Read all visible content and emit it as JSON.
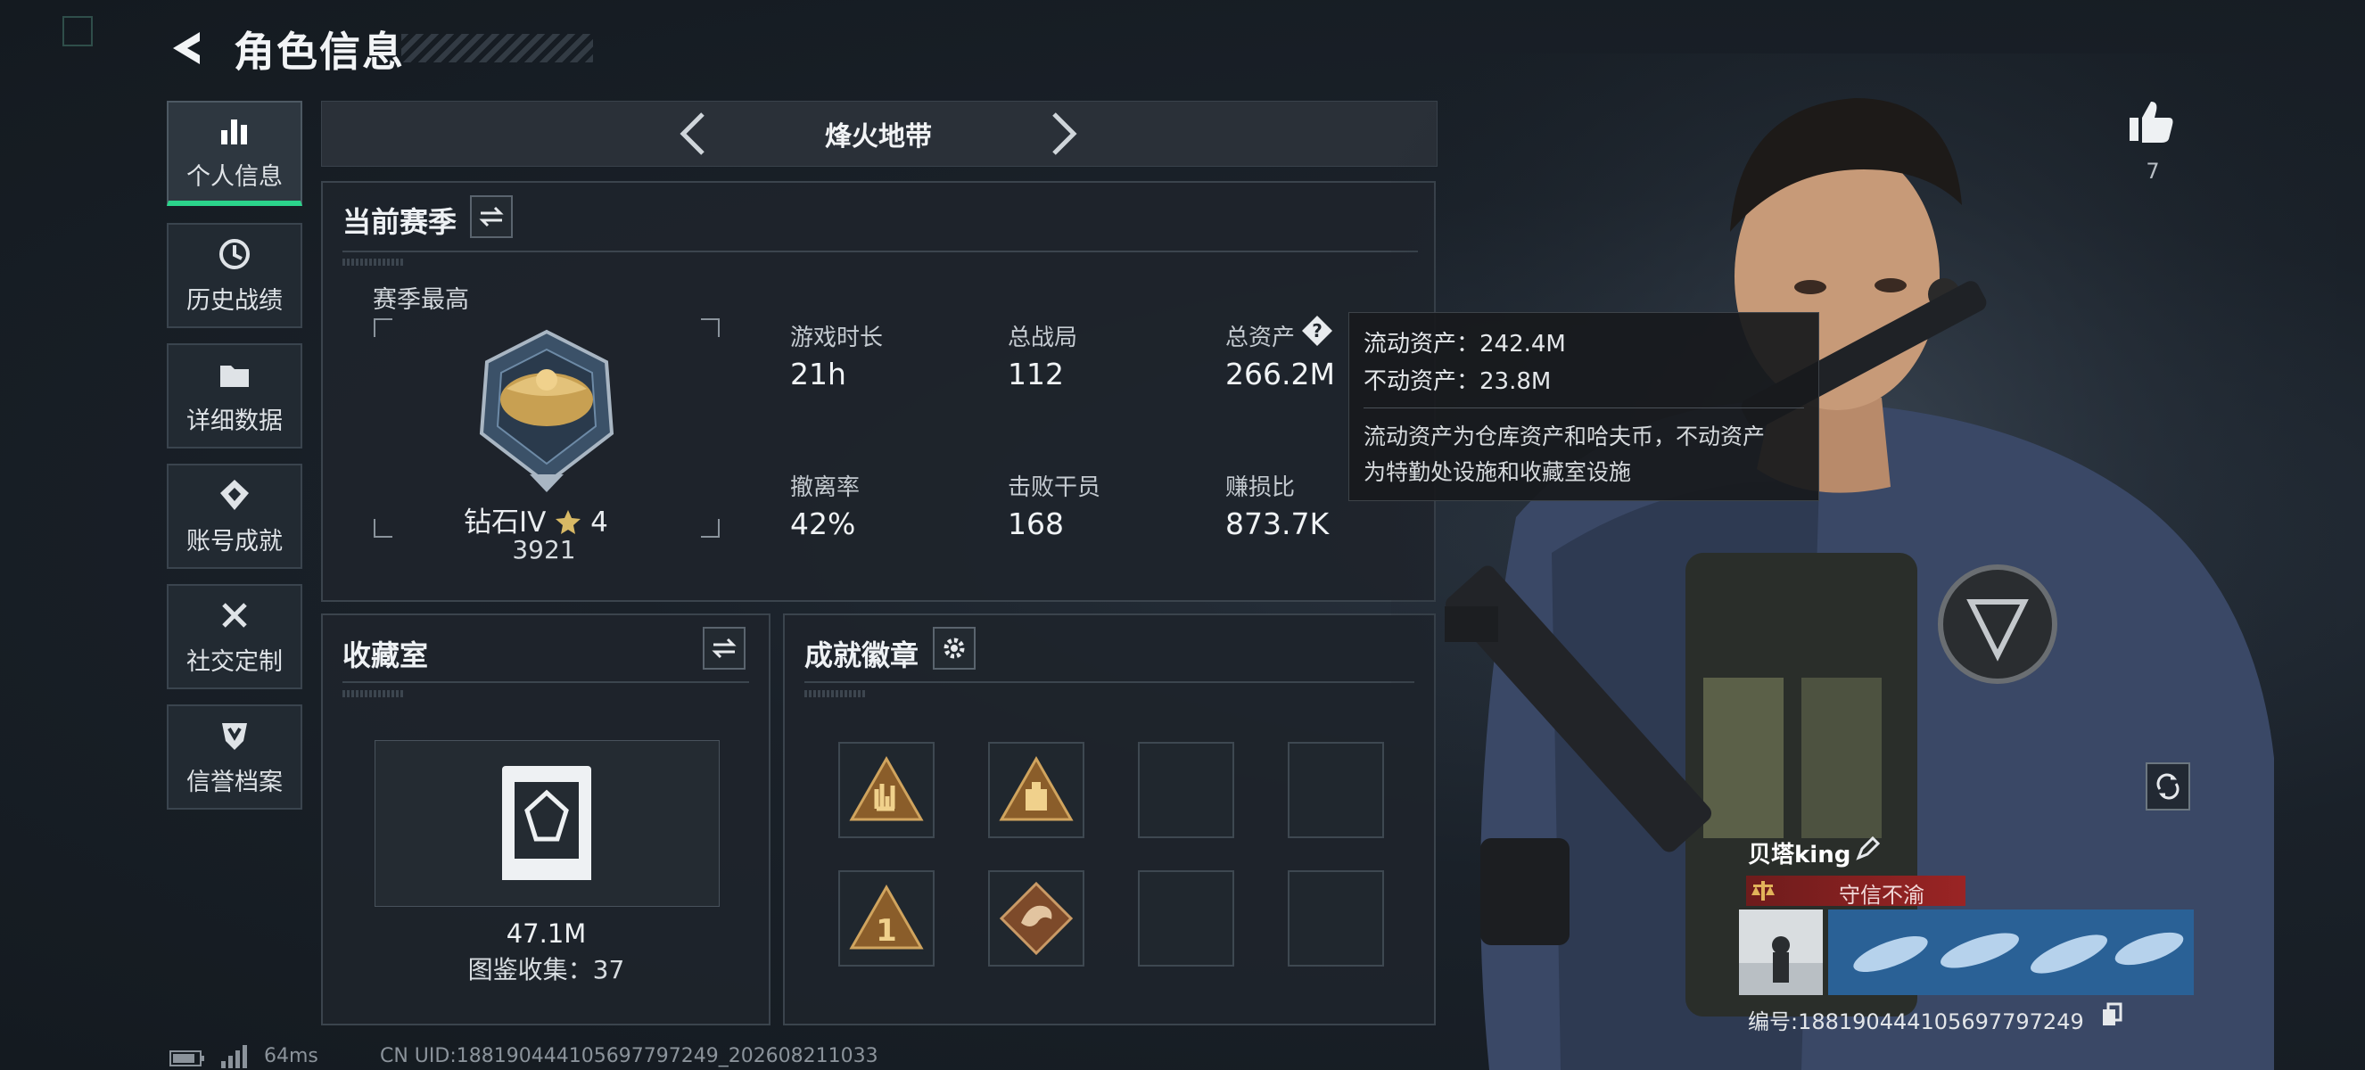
{
  "header": {
    "title": "角色信息"
  },
  "sidebar": {
    "items": [
      {
        "label": "个人信息",
        "icon": "bar-chart-icon",
        "active": true
      },
      {
        "label": "历史战绩",
        "icon": "history-icon"
      },
      {
        "label": "详细数据",
        "icon": "folder-icon"
      },
      {
        "label": "账号成就",
        "icon": "achievement-icon"
      },
      {
        "label": "社交定制",
        "icon": "tools-icon"
      },
      {
        "label": "信誉档案",
        "icon": "credit-icon"
      }
    ]
  },
  "mode": {
    "name": "烽火地带"
  },
  "season": {
    "title": "当前赛季",
    "best_label": "赛季最高",
    "rank_name": "钻石IV",
    "rank_stars": "4",
    "rank_score": "3921",
    "stats": [
      {
        "label": "游戏时长",
        "value": "21h"
      },
      {
        "label": "总战局",
        "value": "112"
      },
      {
        "label": "总资产",
        "value": "266.2M"
      },
      {
        "label": "撤离率",
        "value": "42%"
      },
      {
        "label": "击败干员",
        "value": "168"
      },
      {
        "label": "赚损比",
        "value": "873.7K"
      }
    ]
  },
  "tooltip": {
    "liquid": "流动资产：242.4M",
    "fixed": "不动资产：23.8M",
    "desc_line1": "流动资产为仓库资产和哈夫币，不动资产",
    "desc_line2": "为特勤处设施和收藏室设施"
  },
  "collection": {
    "title": "收藏室",
    "value": "47.1M",
    "count": "图鉴收集：37"
  },
  "achievements": {
    "title": "成就徽章",
    "badges": [
      "rock-hand-badge",
      "loot-crate-badge",
      "",
      "",
      "number-one-badge",
      "dragon-badge",
      "",
      ""
    ]
  },
  "likes": {
    "count": "7"
  },
  "player": {
    "name": "贝塔king",
    "honor": "守信不渝",
    "id": "编号:18819044410569779724​9"
  },
  "footer": {
    "ping": "64ms",
    "uid": "CN UID:18819044410569779​7249_202608211033"
  },
  "colors": {
    "accent": "#2bd48b",
    "honor": "#9a2424",
    "panel": "#1e242b"
  }
}
